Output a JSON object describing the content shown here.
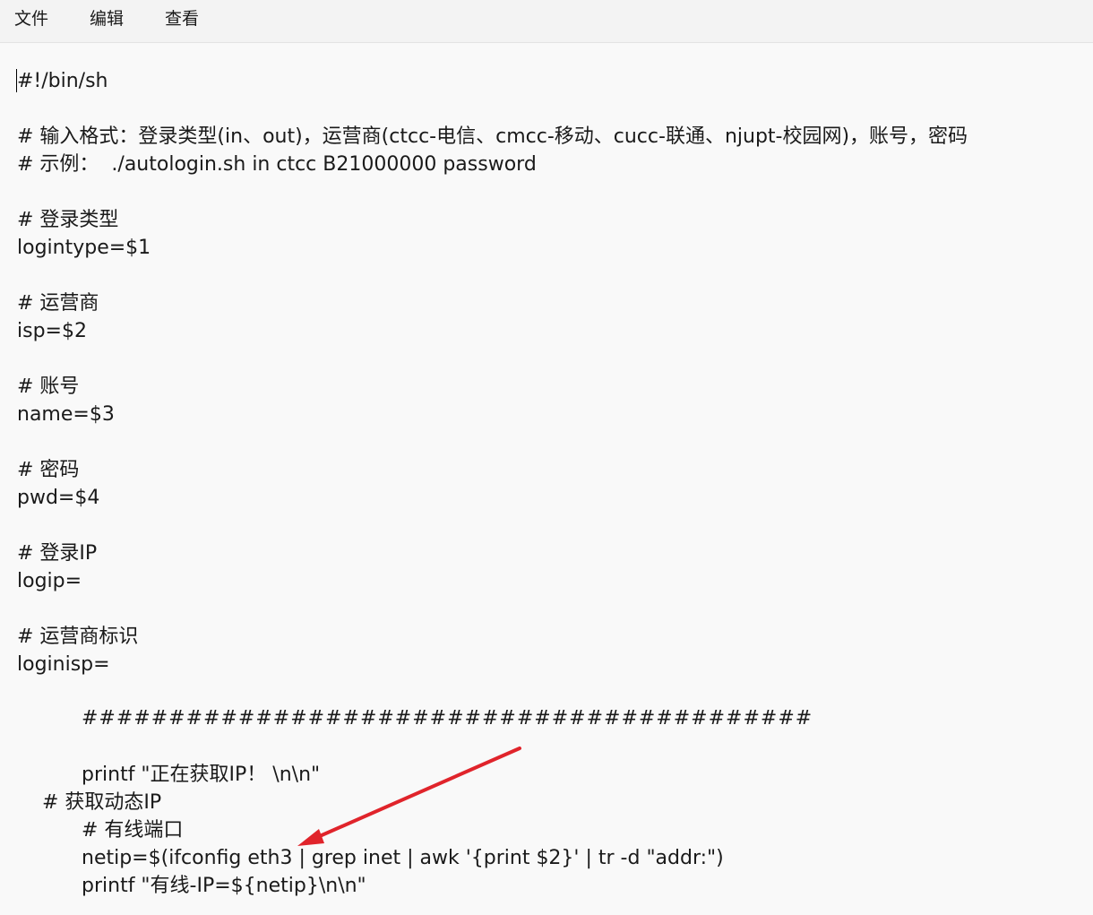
{
  "menu": {
    "file": "文件",
    "edit": "编辑",
    "view": "查看"
  },
  "lines": [
    "#!/bin/sh",
    "# 输入格式：登录类型(in、out)，运营商(ctcc-电信、cmcc-移动、cucc-联通、njupt-校园网)，账号，密码",
    "# 示例：  ./autologin.sh in ctcc B21000000 password",
    "# 登录类型",
    "logintype=$1",
    "# 运营商",
    "isp=$2",
    "# 账号",
    "name=$3",
    "# 密码",
    "pwd=$4",
    "# 登录IP",
    "logip=",
    "# 运营商标识",
    "loginisp=",
    "##########################################",
    "printf \"正在获取IP！ \\n\\n\"",
    "# 获取动态IP",
    "# 有线端口",
    "netip=$(ifconfig eth3 | grep inet | awk '{print $2}' | tr -d \"addr:\")",
    "printf \"有线-IP=${netip}\\n\\n\""
  ],
  "annotation": {
    "arrow_color": "#e0242b"
  }
}
